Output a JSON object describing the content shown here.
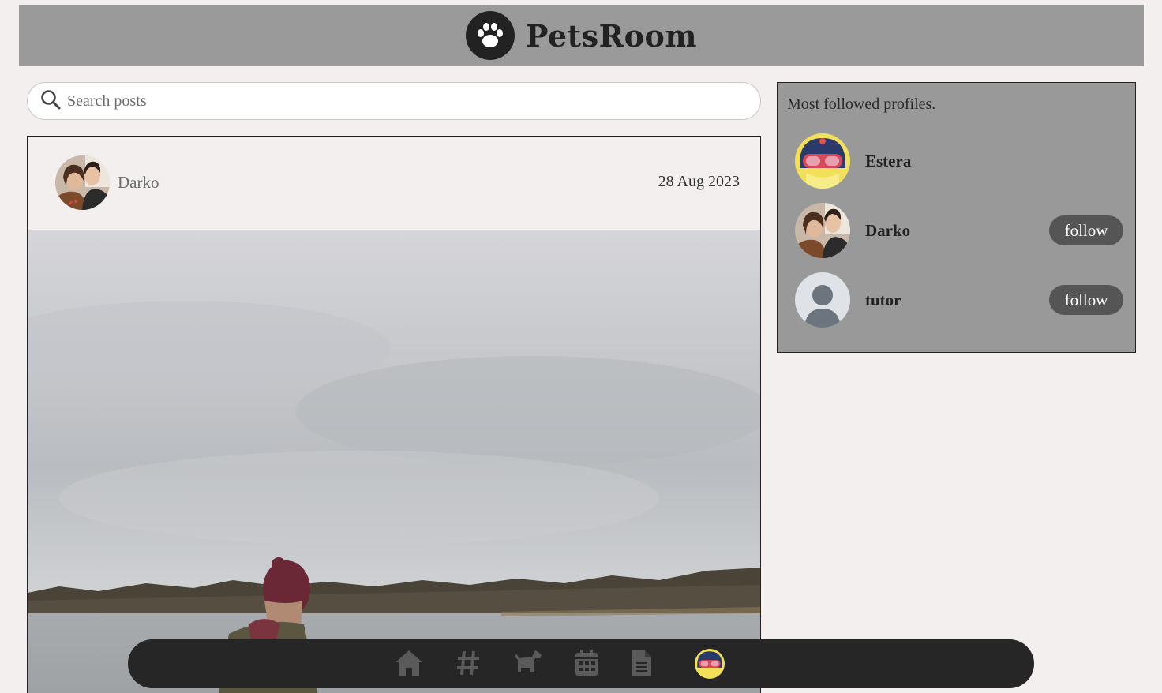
{
  "header": {
    "brand": "PetsRoom",
    "logo_icon": "paw-icon"
  },
  "search": {
    "placeholder": "Search posts",
    "value": "",
    "icon": "search-icon"
  },
  "post": {
    "author": "Darko",
    "date": "28 Aug 2023",
    "avatar_icon": "user-avatar-photo",
    "image": "lake-landscape-photo"
  },
  "sidebar": {
    "title": "Most followed profiles.",
    "profiles": [
      {
        "name": "Estera",
        "follow_label": ""
      },
      {
        "name": "Darko",
        "follow_label": "follow"
      },
      {
        "name": "tutor",
        "follow_label": "follow"
      }
    ]
  },
  "bottom_nav": {
    "items": [
      "home-icon",
      "hashtag-icon",
      "dog-icon",
      "calendar-icon",
      "document-icon",
      "profile-avatar"
    ]
  },
  "colors": {
    "background": "#f2efee",
    "header": "#9a9a9a",
    "sidebar": "#999999",
    "nav": "#262626",
    "nav_icon": "#5a5a5a",
    "button": "#555555"
  }
}
